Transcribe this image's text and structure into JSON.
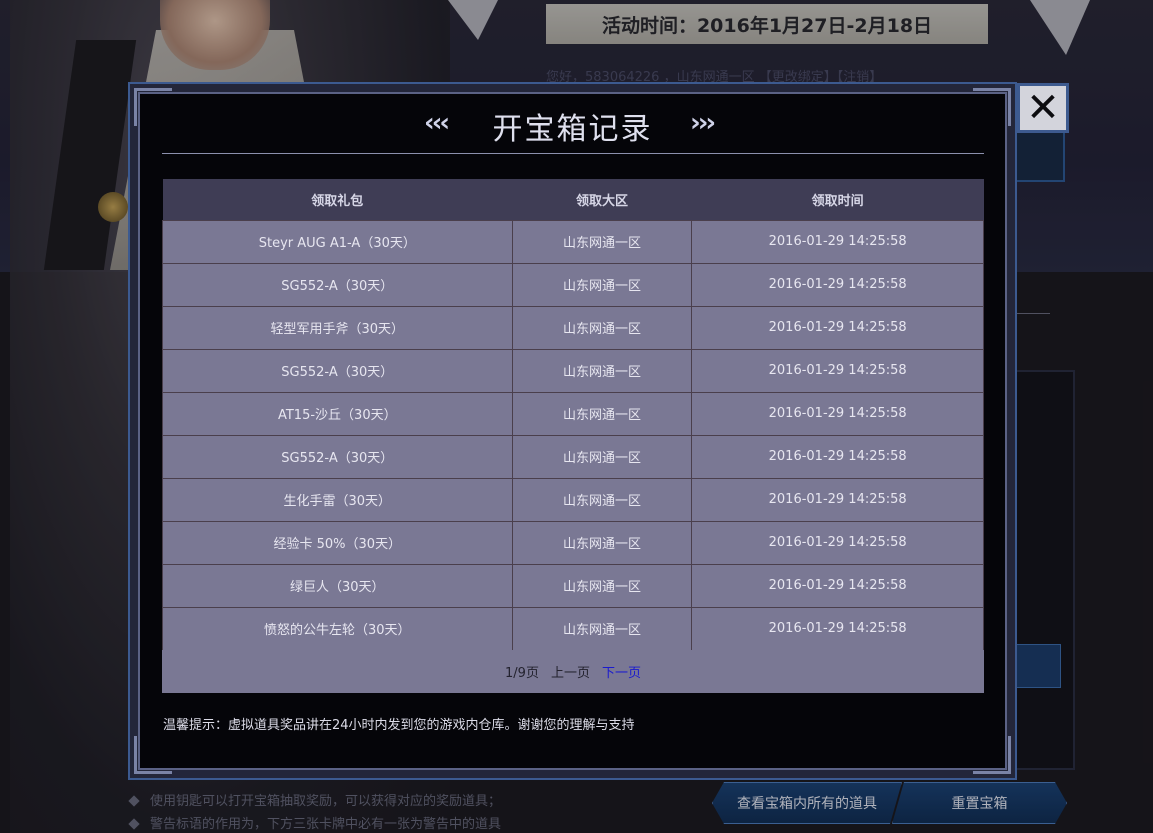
{
  "page": {
    "event_banner": "活动时间：2016年1月27日-2月18日",
    "user_line": "您好，583064226 ，山东网通一区 【更改绑定】【注销】",
    "notes": [
      "使用钥匙可以打开宝箱抽取奖励，可以获得对应的奖励道具；",
      "警告标语的作用为，下方三张卡牌中必有一张为警告中的道具"
    ],
    "buttons": {
      "view_items": "查看宝箱内所有的道具",
      "reset_box": "重置宝箱"
    }
  },
  "modal": {
    "title": "开宝箱记录",
    "chevron_left": "‹‹‹",
    "chevron_right": "›››",
    "close_label": "✕",
    "columns": [
      "领取礼包",
      "领取大区",
      "领取时间"
    ],
    "rows": [
      [
        "Steyr AUG A1-A（30天）",
        "山东网通一区",
        "2016-01-29 14:25:58"
      ],
      [
        "SG552-A（30天）",
        "山东网通一区",
        "2016-01-29 14:25:58"
      ],
      [
        "轻型军用手斧（30天）",
        "山东网通一区",
        "2016-01-29 14:25:58"
      ],
      [
        "SG552-A（30天）",
        "山东网通一区",
        "2016-01-29 14:25:58"
      ],
      [
        "AT15-沙丘（30天）",
        "山东网通一区",
        "2016-01-29 14:25:58"
      ],
      [
        "SG552-A（30天）",
        "山东网通一区",
        "2016-01-29 14:25:58"
      ],
      [
        "生化手雷（30天）",
        "山东网通一区",
        "2016-01-29 14:25:58"
      ],
      [
        "经验卡 50%（30天）",
        "山东网通一区",
        "2016-01-29 14:25:58"
      ],
      [
        "绿巨人（30天）",
        "山东网通一区",
        "2016-01-29 14:25:58"
      ],
      [
        "愤怒的公牛左轮（30天）",
        "山东网通一区",
        "2016-01-29 14:25:58"
      ]
    ],
    "pager": {
      "current": "1/9页",
      "prev": "上一页",
      "next": "下一页"
    },
    "tip": "温馨提示：虚拟道具奖品讲在24小时内发到您的游戏内仓库。谢谢您的理解与支持"
  },
  "colors": {
    "modal_bg": "#050509",
    "modal_border": "#3c5a90",
    "table_header": "#3f3d55",
    "table_cell": "#7a7894",
    "link": "#1a1acf"
  },
  "icons": {
    "close": "close-icon",
    "left_chevrons": "chevrons-left-icon",
    "right_chevrons": "chevrons-right-icon"
  }
}
